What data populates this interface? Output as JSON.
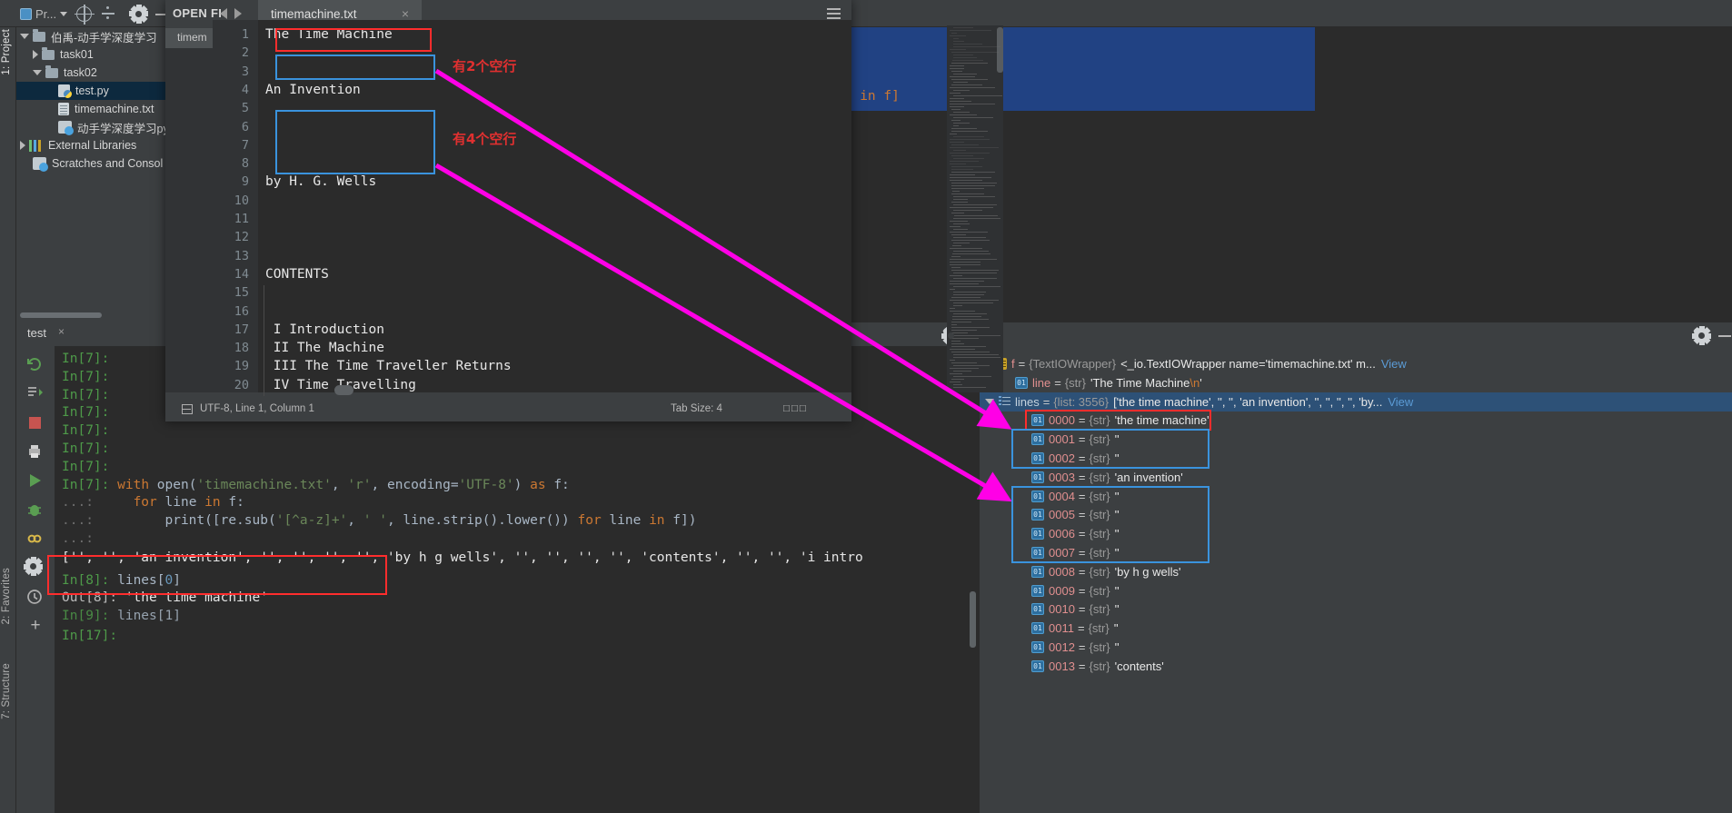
{
  "toolbar": {
    "project_label": "Pr...",
    "icons": [
      "project-select-icon",
      "locate-icon",
      "collapse-all-icon",
      "settings-gear-icon",
      "minimize-icon"
    ]
  },
  "left_strip": {
    "tabs": [
      "1: Project",
      "2: Favorites",
      "7: Structure"
    ]
  },
  "project_tree": {
    "items": [
      {
        "label": "伯禹-动手学深度学习",
        "icon": "folder-icon",
        "arrow": "down",
        "depth": 0,
        "selected": false
      },
      {
        "label": "task01",
        "icon": "folder-icon",
        "arrow": "right",
        "depth": 1,
        "selected": false
      },
      {
        "label": "task02",
        "icon": "folder-icon",
        "arrow": "down",
        "depth": 1,
        "selected": false
      },
      {
        "label": "test.py",
        "icon": "python-file-icon",
        "arrow": "none",
        "depth": 2,
        "selected": true
      },
      {
        "label": "timemachine.txt",
        "icon": "text-file-icon",
        "arrow": "none",
        "depth": 2,
        "selected": false
      },
      {
        "label": "动手学深度学习pyto",
        "icon": "unknown-file-icon",
        "arrow": "none",
        "depth": 2,
        "selected": false
      },
      {
        "label": "External Libraries",
        "icon": "libraries-icon",
        "arrow": "right",
        "depth": 0,
        "selected": false
      },
      {
        "label": "Scratches and Consol",
        "icon": "scratches-icon",
        "arrow": "none",
        "depth": 0,
        "selected": false
      }
    ]
  },
  "editor_window": {
    "open_files_label": "OPEN FI",
    "sub_tab_label": "timem",
    "tab_title": "timemachine.txt",
    "close_label": "×",
    "status_left": "UTF-8, Line 1, Column 1",
    "status_tab_size": "Tab Size: 4",
    "status_right": "□□□",
    "lines": [
      {
        "no": "1",
        "text": "The Time Machine"
      },
      {
        "no": "2",
        "text": ""
      },
      {
        "no": "3",
        "text": ""
      },
      {
        "no": "4",
        "text": "An Invention"
      },
      {
        "no": "5",
        "text": ""
      },
      {
        "no": "6",
        "text": ""
      },
      {
        "no": "7",
        "text": ""
      },
      {
        "no": "8",
        "text": ""
      },
      {
        "no": "9",
        "text": "by H. G. Wells"
      },
      {
        "no": "10",
        "text": ""
      },
      {
        "no": "11",
        "text": ""
      },
      {
        "no": "12",
        "text": ""
      },
      {
        "no": "13",
        "text": ""
      },
      {
        "no": "14",
        "text": "CONTENTS"
      },
      {
        "no": "15",
        "text": ""
      },
      {
        "no": "16",
        "text": ""
      },
      {
        "no": "17",
        "text": " I Introduction"
      },
      {
        "no": "18",
        "text": " II The Machine"
      },
      {
        "no": "19",
        "text": " III The Time Traveller Returns"
      },
      {
        "no": "20",
        "text": " IV Time Travelling"
      }
    ]
  },
  "background_editor": {
    "visible_code": "ne in f]"
  },
  "console": {
    "tab_label": "test",
    "tab_close": "×",
    "lines": [
      {
        "prompt": "In[7]:",
        "kind": "blank",
        "text": ""
      },
      {
        "prompt": "In[7]:",
        "kind": "blank",
        "text": ""
      },
      {
        "prompt": "In[7]:",
        "kind": "blank",
        "text": ""
      },
      {
        "prompt": "In[7]:",
        "kind": "blank",
        "text": ""
      },
      {
        "prompt": "In[7]:",
        "kind": "blank",
        "text": ""
      },
      {
        "prompt": "In[7]:",
        "kind": "blank",
        "text": ""
      },
      {
        "prompt": "In[7]:",
        "kind": "blank",
        "text": ""
      },
      {
        "prompt": "In[7]:",
        "kind": "code",
        "text": "with open('timemachine.txt', 'r', encoding='UTF-8') as f:"
      },
      {
        "prompt": "...:",
        "kind": "code",
        "text": "    for line in f:"
      },
      {
        "prompt": "...:",
        "kind": "code",
        "text": "        print([re.sub('[^a-z]+', ' ', line.strip().lower()) for line in f])"
      },
      {
        "prompt": "...:",
        "kind": "code",
        "text": ""
      }
    ],
    "print_output": "['', '', 'an invention', '', '', '', '', 'by h g wells', '', '', '', '', 'contents', '', '', 'i intro",
    "in8_prompt": "In[8]:",
    "in8_code": "lines[0]",
    "out8_prompt": "Out[8]:",
    "out8_value": "'the time machine'",
    "in9_hidden": "lines[1]",
    "in17_prompt": "In[17]:"
  },
  "debug_panel": {
    "variables": [
      {
        "arrow": "right",
        "icon": "object-icon",
        "name": "f",
        "type": "{TextIOWrapper}",
        "value": "<_io.TextIOWrapper name='timemachine.txt' m...",
        "view": "View",
        "indent": 0,
        "selected": false,
        "box": "none"
      },
      {
        "arrow": "none",
        "icon": "str-icon",
        "name": "line",
        "type": "{str}",
        "value": "'The Time Machine\\n'",
        "view": "",
        "indent": 1,
        "selected": false,
        "box": "none"
      },
      {
        "arrow": "down",
        "icon": "list-icon",
        "name": "lines",
        "type": "{list: 3556}",
        "value": "['the time machine', '', '', 'an invention', '', '', '', '', 'by...",
        "view": "View",
        "indent": 0,
        "selected": true,
        "box": "none"
      },
      {
        "arrow": "none",
        "icon": "str-icon",
        "name": "0000",
        "type": "{str}",
        "value": "'the time machine'",
        "view": "",
        "indent": 2,
        "selected": false,
        "box": "red"
      },
      {
        "arrow": "none",
        "icon": "str-icon",
        "name": "0001",
        "type": "{str}",
        "value": "''",
        "view": "",
        "indent": 2,
        "selected": false,
        "box": "blue-top"
      },
      {
        "arrow": "none",
        "icon": "str-icon",
        "name": "0002",
        "type": "{str}",
        "value": "''",
        "view": "",
        "indent": 2,
        "selected": false,
        "box": "blue-bottom"
      },
      {
        "arrow": "none",
        "icon": "str-icon",
        "name": "0003",
        "type": "{str}",
        "value": "'an invention'",
        "view": "",
        "indent": 2,
        "selected": false,
        "box": "none"
      },
      {
        "arrow": "none",
        "icon": "str-icon",
        "name": "0004",
        "type": "{str}",
        "value": "''",
        "view": "",
        "indent": 2,
        "selected": false,
        "box": "blue2-top"
      },
      {
        "arrow": "none",
        "icon": "str-icon",
        "name": "0005",
        "type": "{str}",
        "value": "''",
        "view": "",
        "indent": 2,
        "selected": false,
        "box": "blue2-mid"
      },
      {
        "arrow": "none",
        "icon": "str-icon",
        "name": "0006",
        "type": "{str}",
        "value": "''",
        "view": "",
        "indent": 2,
        "selected": false,
        "box": "blue2-mid"
      },
      {
        "arrow": "none",
        "icon": "str-icon",
        "name": "0007",
        "type": "{str}",
        "value": "''",
        "view": "",
        "indent": 2,
        "selected": false,
        "box": "blue2-bottom"
      },
      {
        "arrow": "none",
        "icon": "str-icon",
        "name": "0008",
        "type": "{str}",
        "value": "'by h g wells'",
        "view": "",
        "indent": 2,
        "selected": false,
        "box": "none"
      },
      {
        "arrow": "none",
        "icon": "str-icon",
        "name": "0009",
        "type": "{str}",
        "value": "''",
        "view": "",
        "indent": 2,
        "selected": false,
        "box": "none"
      },
      {
        "arrow": "none",
        "icon": "str-icon",
        "name": "0010",
        "type": "{str}",
        "value": "''",
        "view": "",
        "indent": 2,
        "selected": false,
        "box": "none"
      },
      {
        "arrow": "none",
        "icon": "str-icon",
        "name": "0011",
        "type": "{str}",
        "value": "''",
        "view": "",
        "indent": 2,
        "selected": false,
        "box": "none"
      },
      {
        "arrow": "none",
        "icon": "str-icon",
        "name": "0012",
        "type": "{str}",
        "value": "''",
        "view": "",
        "indent": 2,
        "selected": false,
        "box": "none"
      },
      {
        "arrow": "none",
        "icon": "str-icon",
        "name": "0013",
        "type": "{str}",
        "value": "'contents'",
        "view": "",
        "indent": 2,
        "selected": false,
        "box": "none"
      }
    ]
  },
  "annotations": {
    "note_two_blank": "有2个空行",
    "note_four_blank": "有4个空行",
    "accent_red": "#ff2d2d",
    "accent_blue": "#3a93dd",
    "accent_magenta": "#ff00e6"
  }
}
